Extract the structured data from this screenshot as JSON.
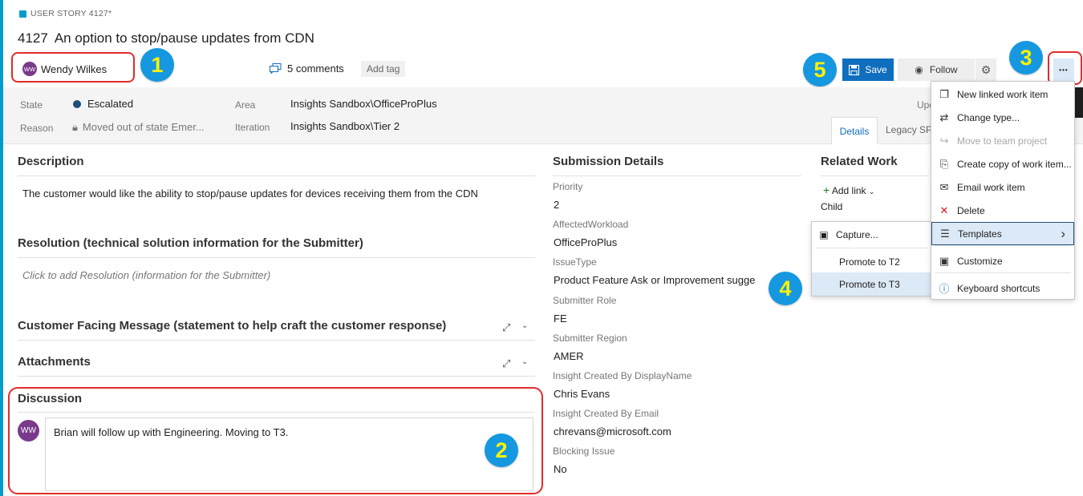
{
  "workitem": {
    "type_label": "USER STORY 4127*",
    "id": "4127",
    "title": "An option to stop/pause updates from CDN",
    "assigned_to": "Wendy Wilkes",
    "assigned_initials": "WW",
    "comments": "5 comments",
    "add_tag": "Add tag"
  },
  "toolbar": {
    "save": "Save",
    "follow": "Follow",
    "more": "•••"
  },
  "fields": {
    "state_label": "State",
    "state_value": "Escalated",
    "reason_label": "Reason",
    "reason_value": "Moved out of state Emer...",
    "area_label": "Area",
    "area_value": "Insights Sandbox\\OfficeProPlus",
    "iteration_label": "Iteration",
    "iteration_value": "Insights Sandbox\\Tier 2",
    "updated_partial": "Upd"
  },
  "tabs": {
    "details": "Details",
    "legacy": "Legacy SPO"
  },
  "left": {
    "description_title": "Description",
    "description_text": "The customer would like the ability to stop/pause updates for devices receiving them from the CDN",
    "resolution_title": "Resolution (technical solution information for the Submitter)",
    "resolution_placeholder": "Click to add Resolution (information for the Submitter)",
    "customer_title": "Customer Facing Message (statement to help craft the customer response)",
    "attachments_title": "Attachments",
    "discussion_title": "Discussion",
    "discussion_avatar": "WW",
    "discussion_text": "Brian will follow up with Engineering. Moving to T3."
  },
  "submission": {
    "title": "Submission Details",
    "fields": [
      {
        "label": "Priority",
        "value": "2"
      },
      {
        "label": "AffectedWorkload",
        "value": "OfficeProPlus"
      },
      {
        "label": "IssueType",
        "value": "Product Feature Ask or Improvement sugge"
      },
      {
        "label": "Submitter Role",
        "value": "FE"
      },
      {
        "label": "Submitter Region",
        "value": "AMER"
      },
      {
        "label": "Insight Created By DisplayName",
        "value": "Chris Evans"
      },
      {
        "label": "Insight Created By Email",
        "value": "chrevans@microsoft.com"
      },
      {
        "label": "Blocking Issue",
        "value": "No"
      }
    ]
  },
  "related": {
    "title": "Related Work",
    "add_link": "Add link",
    "child": "Child"
  },
  "menu": {
    "items": [
      {
        "label": "New linked work item",
        "icon": "new-linked-icon",
        "glyph": "❐",
        "disabled": false
      },
      {
        "label": "Change type...",
        "icon": "change-type-icon",
        "glyph": "⇄",
        "disabled": false
      },
      {
        "label": "Move to team project",
        "icon": "move-icon",
        "glyph": "↪",
        "disabled": true
      },
      {
        "label": "Create copy of work item...",
        "icon": "copy-icon",
        "glyph": "⎘",
        "disabled": false
      },
      {
        "label": "Email work item",
        "icon": "email-icon",
        "glyph": "✉",
        "disabled": false
      },
      {
        "label": "Delete",
        "icon": "delete-icon",
        "glyph": "✕",
        "disabled": false
      },
      {
        "label": "Templates",
        "icon": "templates-icon",
        "glyph": "☰",
        "disabled": false
      },
      {
        "label": "Customize",
        "icon": "customize-icon",
        "glyph": "▣",
        "disabled": false
      },
      {
        "label": "Keyboard shortcuts",
        "icon": "info-icon",
        "glyph": "ⓘ",
        "disabled": false
      }
    ]
  },
  "submenu": {
    "capture": "Capture...",
    "promote_t2": "Promote to T2",
    "promote_t3": "Promote to T3"
  },
  "annotations": {
    "badge1": "1",
    "badge2": "2",
    "badge3": "3",
    "badge4": "4",
    "badge5": "5"
  },
  "colors": {
    "accent": "#106ebe",
    "brand_bar": "#009ccc",
    "annotation_badge": "#1598e0",
    "annotation_text": "#fff200",
    "highlight_box": "#e12b2b",
    "delete": "#e81123",
    "state_dot": "#1f4e79"
  }
}
